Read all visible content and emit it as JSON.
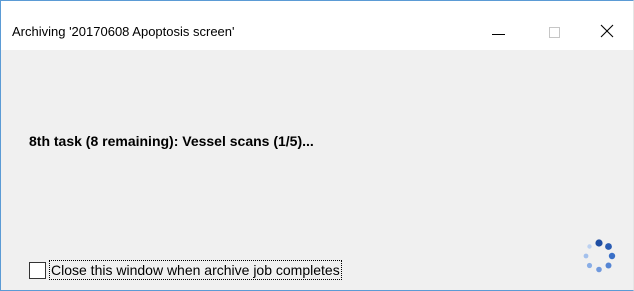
{
  "window": {
    "title": "Archiving '20170608 Apoptosis screen'",
    "minimize_icon": "minimize-icon",
    "maximize_icon": "maximize-icon",
    "close_icon": "close-icon"
  },
  "main": {
    "task_status": "8th task (8 remaining): Vessel scans (1/5)...",
    "close_on_complete": {
      "label": "Close this window when archive job completes",
      "checked": false
    },
    "busy_indicator_icon": "loading-spinner-icon"
  },
  "colors": {
    "window_border": "#5b9bd5",
    "spinner_dot": "#3a6fc7",
    "content_background": "#f0f0f0"
  }
}
